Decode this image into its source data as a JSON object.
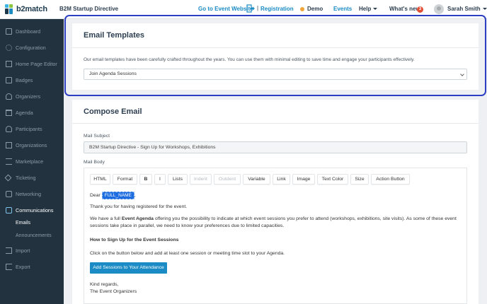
{
  "app": {
    "logo_text": "b2match",
    "event_name": "B2M Startup Directive"
  },
  "topbar": {
    "go_to_event": "Go to Event Website",
    "separator": "|",
    "registration": "Registration",
    "demo": "Demo",
    "events": "Events",
    "help": "Help",
    "whats_new": "What's new",
    "whats_new_count": "3",
    "user_name": "Sarah Smith"
  },
  "sidebar": {
    "items": [
      {
        "label": "Dashboard",
        "icon": "dashboard-icon"
      },
      {
        "label": "Configuration",
        "icon": "gear-icon"
      },
      {
        "label": "Home Page Editor",
        "icon": "home-icon"
      },
      {
        "label": "Badges",
        "icon": "badge-icon"
      },
      {
        "label": "Organizers",
        "icon": "organizers-icon"
      },
      {
        "label": "Agenda",
        "icon": "calendar-icon"
      },
      {
        "label": "Participants",
        "icon": "participants-icon"
      },
      {
        "label": "Organizations",
        "icon": "building-icon"
      },
      {
        "label": "Marketplace",
        "icon": "list-icon"
      },
      {
        "label": "Ticketing",
        "icon": "ticket-icon"
      },
      {
        "label": "Networking",
        "icon": "networking-icon"
      },
      {
        "label": "Communications",
        "icon": "chat-icon"
      },
      {
        "label": "Import",
        "icon": "import-icon"
      },
      {
        "label": "Export",
        "icon": "export-icon"
      }
    ],
    "sub_items": [
      {
        "label": "Emails"
      },
      {
        "label": "Announcements"
      }
    ]
  },
  "email_templates": {
    "title": "Email Templates",
    "description": "Our email templates have been carefully crafted throughout the years. You can use them with minimal editing to save time and engage your participants effectively.",
    "selected_template": "Join Agenda Sessions"
  },
  "compose": {
    "title": "Compose Email",
    "subject_label": "Mail Subject",
    "subject_value": "B2M Startup Directive - Sign Up for Workshops, Exhibitions",
    "body_label": "Mail Body",
    "toolbar": {
      "html": "HTML",
      "format": "Format",
      "bold": "B",
      "italic": "I",
      "lists": "Lists",
      "indent": "Indent",
      "outdent": "Outdent",
      "variable": "Variable",
      "link": "Link",
      "image": "Image",
      "text_color": "Text Color",
      "size": "Size",
      "action_button": "Action Button"
    },
    "body": {
      "greeting": "Dear",
      "variable": "FULL_NAME",
      "greeting_end": ",",
      "thanks": "Thank you for having registered for the event.",
      "p1_start": "We have a full",
      "p1_bold": "Event Agenda",
      "p1_line1_rest": "offering you the possibility to indicate at which event sessions you prefer to attend (workshops, exhibitions, site visits). As some of these event",
      "p1_line2": "sessions take place in parallel, we need to know your preferences due to limited capacities.",
      "heading": "How to Sign Up for the Event Sessions",
      "instruction": "Click on the button below and add at least one session or meeting time slot to your Agenda.",
      "cta": "Add Sessions to Your Attendance",
      "regards": "Kind regards,",
      "signature": "The Event Organizers"
    }
  },
  "colors": {
    "accent": "#1a8bc4",
    "sidebar_bg": "#22333f",
    "highlight": "#2d3fc2"
  }
}
